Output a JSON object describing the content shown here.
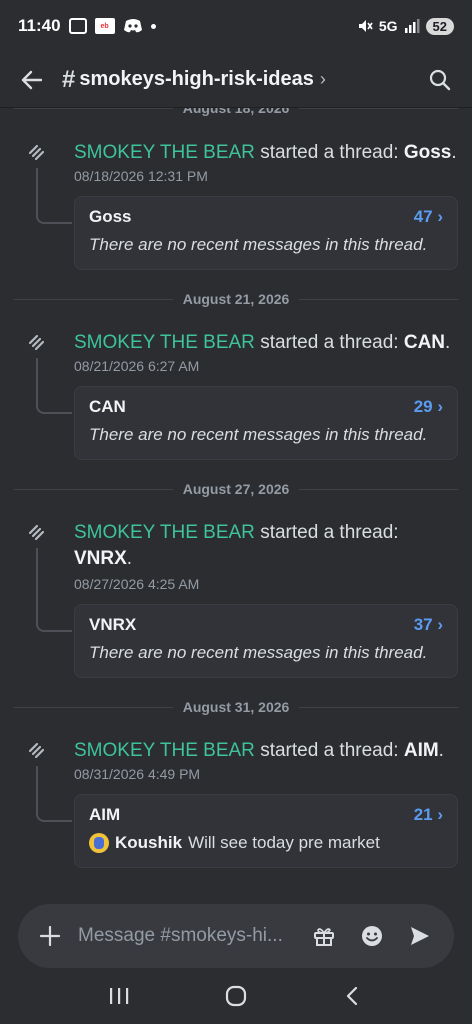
{
  "status_bar": {
    "time": "11:40",
    "network": "5G",
    "battery": "52"
  },
  "header": {
    "channel_name": "smokeys-high-risk-ideas"
  },
  "feed": {
    "partial_divider": "August 18, 2026",
    "entries": [
      {
        "author": "SMOKEY THE BEAR",
        "action": " started a thread: ",
        "thread_name": "Goss",
        "suffix": ".",
        "timestamp": "08/18/2026 12:31 PM",
        "card_title": "Goss",
        "card_count": "47",
        "card_preview": "There are no recent messages in this thread."
      },
      {
        "divider": "August 21, 2026",
        "author": "SMOKEY THE BEAR",
        "action": " started a thread: ",
        "thread_name": "CAN",
        "suffix": ".",
        "timestamp": "08/21/2026 6:27 AM",
        "card_title": "CAN",
        "card_count": "29",
        "card_preview": "There are no recent messages in this thread."
      },
      {
        "divider": "August 27, 2026",
        "author": "SMOKEY THE BEAR",
        "action": " started a thread: ",
        "thread_name": "VNRX",
        "suffix": ".",
        "timestamp": "08/27/2026 4:25 AM",
        "card_title": "VNRX",
        "card_count": "37",
        "card_preview": "There are no recent messages in this thread."
      },
      {
        "divider": "August 31, 2026",
        "author": "SMOKEY THE BEAR",
        "action": " started a thread: ",
        "thread_name": "AIM",
        "suffix": ".",
        "timestamp": "08/31/2026 4:49 PM",
        "card_title": "AIM",
        "card_count": "21",
        "preview_author": "Koushik",
        "preview_text": "Will see today pre market"
      }
    ]
  },
  "composer": {
    "placeholder": "Message #smokeys-hi..."
  },
  "colors": {
    "background": "#2b2d31",
    "author": "#3ec39b",
    "link_count": "#5b9cf0"
  },
  "icons": {
    "back": "arrow-left-icon",
    "search": "search-icon",
    "thread": "thread-icon",
    "gift": "gift-icon",
    "emoji": "emoji-icon",
    "send": "send-icon"
  }
}
